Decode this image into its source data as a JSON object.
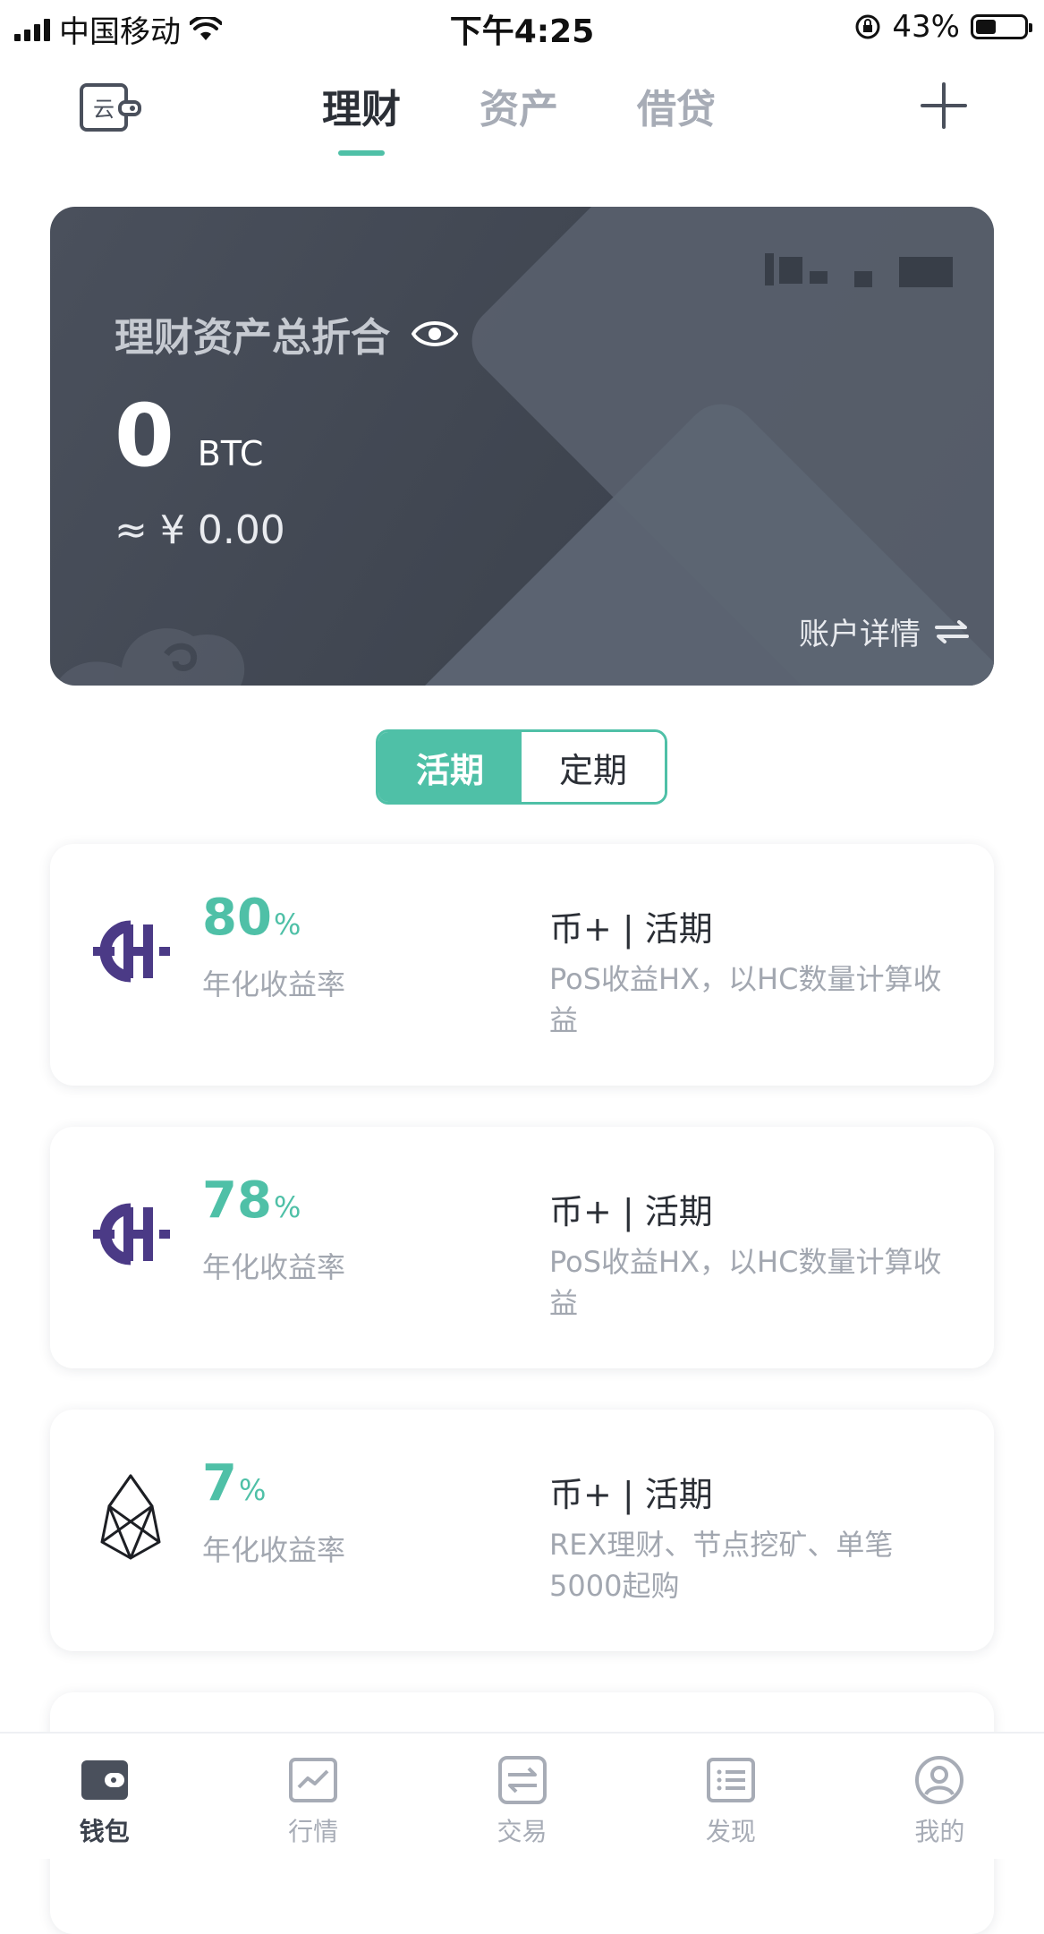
{
  "status_bar": {
    "carrier": "中国移动",
    "time": "下午4:25",
    "battery_percent": "43%",
    "battery_level": 0.43
  },
  "top_nav": {
    "tabs": [
      {
        "label": "理财",
        "active": true
      },
      {
        "label": "资产",
        "active": false
      },
      {
        "label": "借贷",
        "active": false
      }
    ],
    "left_icon": "cloud-wallet-icon",
    "right_icon": "plus-icon"
  },
  "asset_card": {
    "title": "理财资产总折合",
    "amount": "0",
    "unit": "BTC",
    "cny": "≈ ¥ 0.00",
    "detail_link": "账户详情"
  },
  "segment": {
    "options": [
      "活期",
      "定期"
    ],
    "selected": "活期"
  },
  "products": [
    {
      "icon": "hcash-icon",
      "rate": "80",
      "rate_unit": "%",
      "rate_label": "年化收益率",
      "title": "币+ | 活期",
      "desc": "PoS收益HX，以HC数量计算收益"
    },
    {
      "icon": "hcash-icon",
      "rate": "78",
      "rate_unit": "%",
      "rate_label": "年化收益率",
      "title": "币+ | 活期",
      "desc": "PoS收益HX，以HC数量计算收益"
    },
    {
      "icon": "eos-icon",
      "rate": "7",
      "rate_unit": "%",
      "rate_label": "年化收益率",
      "title": "币+ | 活期",
      "desc": "REX理财、节点挖矿、单笔5000起购"
    }
  ],
  "bottom_nav": [
    {
      "label": "钱包",
      "icon": "wallet-icon",
      "active": true
    },
    {
      "label": "行情",
      "icon": "chart-icon",
      "active": false
    },
    {
      "label": "交易",
      "icon": "exchange-icon",
      "active": false
    },
    {
      "label": "发现",
      "icon": "list-icon",
      "active": false
    },
    {
      "label": "我的",
      "icon": "profile-icon",
      "active": false
    }
  ],
  "colors": {
    "accent": "#4fc0a7",
    "card_bg": "#434955",
    "text_primary": "#2b2f36",
    "text_secondary": "#a2a7b0",
    "hcash_purple": "#4b3a86"
  }
}
